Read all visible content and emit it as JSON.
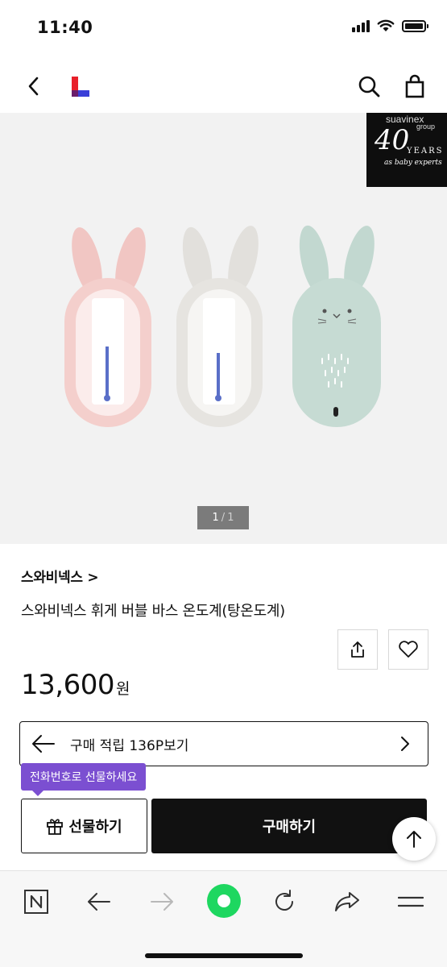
{
  "status_bar": {
    "time": "11:40"
  },
  "header": {
    "logo": "L"
  },
  "gallery": {
    "badge": {
      "brand": "suavinex",
      "group": "group",
      "number": "40",
      "years": "YEARS",
      "tagline": "as baby experts"
    },
    "pager": {
      "current": "1",
      "separator": "/",
      "total": "1"
    }
  },
  "product": {
    "brand_link": "스와비넥스 >",
    "title": "스와비넥스 휘게 버블 바스 온도계(탕온도계)",
    "price": "13,600",
    "currency": "원"
  },
  "points": {
    "text": "구매 적립 136P보기"
  },
  "tooltip": {
    "text": "전화번호로 선물하세요"
  },
  "actions": {
    "gift_label": "선물하기",
    "buy_label": "구매하기"
  },
  "colors": {
    "accent_purple": "#7b4fd1",
    "logo_red": "#e8202a",
    "logo_blue": "#3a3fd8",
    "browser_green": "#1ed760",
    "buy_button": "#111111"
  }
}
